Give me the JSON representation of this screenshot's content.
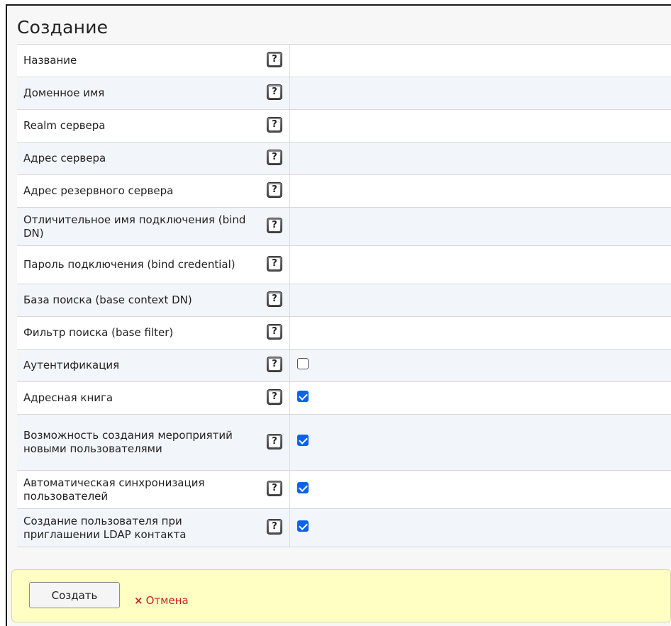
{
  "page": {
    "title": "Создание"
  },
  "fields": [
    {
      "label": "Название",
      "type": "text"
    },
    {
      "label": "Доменное имя",
      "type": "text"
    },
    {
      "label": "Realm сервера",
      "type": "text"
    },
    {
      "label": "Адрес сервера",
      "type": "text"
    },
    {
      "label": "Адрес резервного сервера",
      "type": "text"
    },
    {
      "label": "Отличительное имя подключения (bind DN)",
      "type": "text"
    },
    {
      "label": "Пароль подключения (bind credential)",
      "type": "text"
    },
    {
      "label": "База поиска (base context DN)",
      "type": "text"
    },
    {
      "label": "Фильтр поиска (base filter)",
      "type": "text"
    },
    {
      "label": "Аутентификация",
      "type": "checkbox",
      "checked": false
    },
    {
      "label": "Адресная книга",
      "type": "checkbox",
      "checked": true
    },
    {
      "label": "Возможность создания мероприятий новыми пользователями",
      "type": "checkbox",
      "checked": true
    },
    {
      "label": "Автоматическая синхронизация пользователей",
      "type": "checkbox",
      "checked": true
    },
    {
      "label": "Создание пользователя при приглашении LDAP контакта",
      "type": "checkbox",
      "checked": true
    }
  ],
  "help_icon": {
    "glyph": "?",
    "icon": "help-icon"
  },
  "actions": {
    "create_label": "Создать",
    "cancel_icon": "×",
    "cancel_label": "Отмена"
  },
  "colors": {
    "checkbox_checked": "#0b63e8",
    "footer_bg": "#ffffc4",
    "cancel": "#cc2222"
  }
}
